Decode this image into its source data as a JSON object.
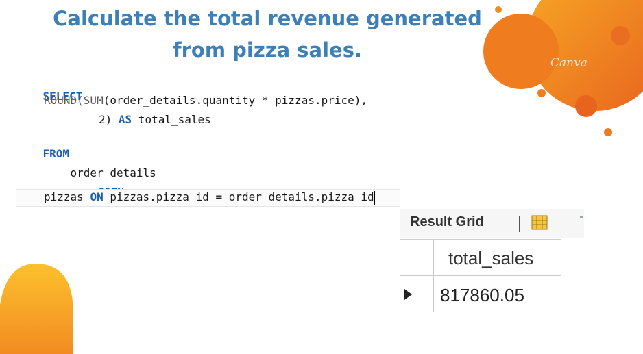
{
  "title": {
    "line1": "Calculate the total revenue generated",
    "line2": "from pizza sales."
  },
  "sql": {
    "select_kw": "SELECT",
    "round_fn": "ROUND(",
    "sum_fn": "SUM",
    "select_expr": "(order_details.quantity * pizzas.price),",
    "round_arg": "2)",
    "as_kw": "AS",
    "alias": "total_sales",
    "from_kw": "FROM",
    "table1": "order_details",
    "join_kw": "JOIN",
    "table2": "pizzas",
    "on_kw": "ON",
    "condition": "pizzas.pizza_id = order_details.pizza_id"
  },
  "result_grid": {
    "label": "Result Grid",
    "separator": "|",
    "column": "total_sales",
    "value": "817860.05"
  },
  "watermark": "Canva",
  "colors": {
    "title": "#3d80b8",
    "keyword": "#1a5fb4",
    "accent_orange": "#f08a24",
    "accent_yellow": "#fcc02d"
  }
}
